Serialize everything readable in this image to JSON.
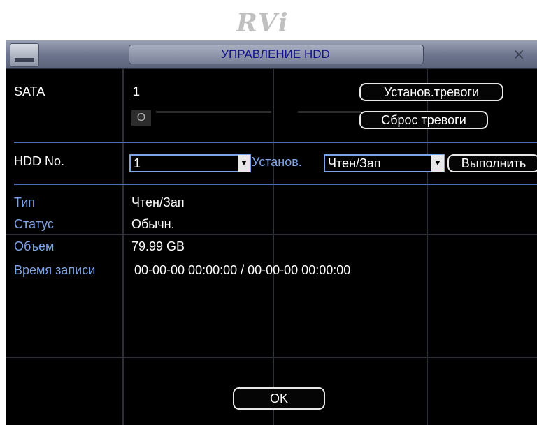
{
  "logo": "RVi",
  "title": "УПРАВЛЕНИЕ HDD",
  "close_symbol": "×",
  "sata": {
    "label": "SATA",
    "number": "1",
    "status_mark": "O"
  },
  "buttons": {
    "set_alarm": "Установ.тревоги",
    "reset_alarm": "Сброс тревоги",
    "execute": "Выполнить",
    "ok": "OK"
  },
  "hdd_no": {
    "label": "HDD No.",
    "value": "1"
  },
  "set": {
    "label": "Установ.",
    "value": "Чтен/Зап"
  },
  "info": {
    "type_label": "Тип",
    "type_value": "Чтен/Зап",
    "status_label": "Статус",
    "status_value": "Обычн.",
    "capacity_label": "Объем",
    "capacity_value": "79.99 GB",
    "rec_time_label": "Время записи",
    "rec_time_value": "00-00-00 00:00:00 / 00-00-00 00:00:00"
  },
  "icons": {
    "window": "hdd-icon",
    "close": "close-icon",
    "dropdown": "triangle-down-icon"
  }
}
